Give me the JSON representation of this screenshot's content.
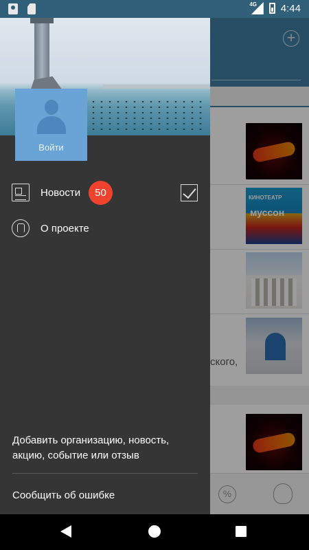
{
  "status_bar": {
    "time": "4:44",
    "network": "4G",
    "icons": [
      "location-icon",
      "sd-card-icon",
      "seagull-icon",
      "signal-icon",
      "battery-icon"
    ]
  },
  "background_app": {
    "header_action_icon": "plus-icon",
    "visible_text": "ского,",
    "bottom_icons": [
      "percent-icon",
      "award-icon"
    ],
    "percent_symbol": "%"
  },
  "drawer": {
    "login_label": "Войти",
    "menu": [
      {
        "label": "Новости",
        "icon": "newspaper-icon",
        "badge": "50",
        "trailing_icon": "checkbox-icon"
      },
      {
        "label": "О проекте",
        "icon": "hand-icon"
      }
    ],
    "footer": {
      "add_link": "Добавить организацию, новость, акцию, событие или отзыв",
      "report_link": "Сообщить об ошибке"
    }
  },
  "colors": {
    "drawer_bg": "#353535",
    "badge": "#f0432d",
    "avatar_card": "#6aa3d6",
    "header": "#3f7ea2"
  },
  "nav_bar": {
    "buttons": [
      "back-icon",
      "home-icon",
      "recent-apps-icon"
    ]
  }
}
